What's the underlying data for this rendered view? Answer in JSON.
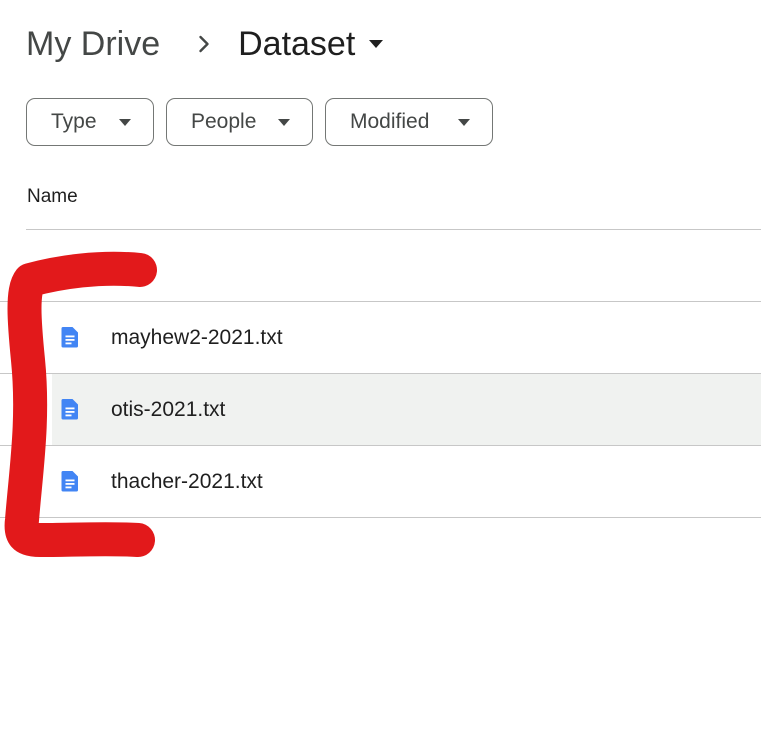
{
  "breadcrumb": {
    "root": "My Drive",
    "current": "Dataset",
    "separator_icon": "chevron-right-icon",
    "caret_icon": "caret-down-icon"
  },
  "filters": [
    {
      "label": "Type",
      "icon": "caret-down-icon"
    },
    {
      "label": "People",
      "icon": "caret-down-icon"
    },
    {
      "label": "Modified",
      "icon": "caret-down-icon"
    }
  ],
  "list": {
    "column_name": "Name",
    "files": [
      {
        "name": "mayhew2-2021.txt",
        "icon": "text-file-icon"
      },
      {
        "name": "otis-2021.txt",
        "icon": "text-file-icon"
      },
      {
        "name": "thacher-2021.txt",
        "icon": "text-file-icon"
      }
    ]
  },
  "colors": {
    "file_icon": "#4285f4",
    "annotation": "#e2191b",
    "selected_row": "#f0f2f0"
  }
}
